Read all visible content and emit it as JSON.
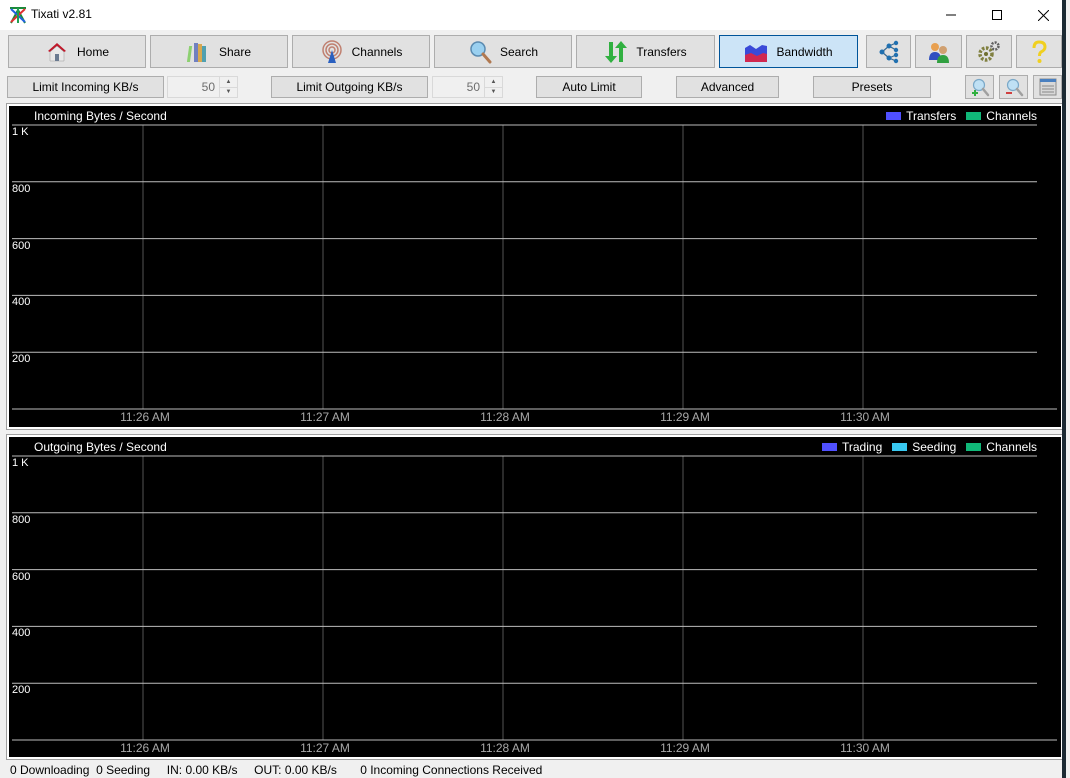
{
  "window": {
    "title": "Tixati v2.81",
    "controls": {
      "minimize": "minimize",
      "maximize": "maximize",
      "close": "close"
    }
  },
  "toolbar": {
    "buttons": [
      {
        "label": "Home",
        "icon": "home-icon",
        "active": false
      },
      {
        "label": "Share",
        "icon": "books-icon",
        "active": false
      },
      {
        "label": "Channels",
        "icon": "antenna-icon",
        "active": false
      },
      {
        "label": "Search",
        "icon": "magnifier-icon",
        "active": false
      },
      {
        "label": "Transfers",
        "icon": "up-down-arrows-icon",
        "active": false
      },
      {
        "label": "Bandwidth",
        "icon": "bandwidth-graph-icon",
        "active": true
      }
    ],
    "icon_buttons": [
      {
        "name": "peers-network-button",
        "icon": "network-nodes-icon"
      },
      {
        "name": "users-button",
        "icon": "users-icon"
      },
      {
        "name": "settings-button",
        "icon": "gears-icon"
      },
      {
        "name": "help-button",
        "icon": "question-mark-icon"
      }
    ]
  },
  "bandwidth_toolbar": {
    "limit_incoming_label": "Limit Incoming KB/s",
    "limit_incoming_value": "50",
    "limit_outgoing_label": "Limit Outgoing KB/s",
    "limit_outgoing_value": "50",
    "auto_limit_label": "Auto Limit",
    "advanced_label": "Advanced",
    "presets_label": "Presets",
    "zoom_in": "zoom-in",
    "zoom_out": "zoom-out",
    "view_options": "view-options"
  },
  "colors": {
    "transfers": "#5050ff",
    "trading": "#5050ff",
    "seeding": "#38c8f0",
    "channels": "#10b878",
    "accent": "#005499"
  },
  "chart_data": [
    {
      "type": "line",
      "title": "Incoming Bytes / Second",
      "xlabel": "",
      "ylabel": "",
      "y_ticks": [
        "200",
        "400",
        "600",
        "800",
        "1 K"
      ],
      "y_tick_values": [
        200,
        400,
        600,
        800,
        1000
      ],
      "ylim": [
        0,
        1000
      ],
      "x_ticks": [
        "11:26 AM",
        "11:27 AM",
        "11:28 AM",
        "11:29 AM",
        "11:30 AM"
      ],
      "grid": true,
      "legend_position": "top-right",
      "series": [
        {
          "name": "Transfers",
          "color": "#5050ff",
          "values": [
            0,
            0,
            0,
            0,
            0
          ]
        },
        {
          "name": "Channels",
          "color": "#10b878",
          "values": [
            0,
            0,
            0,
            0,
            0
          ]
        }
      ]
    },
    {
      "type": "line",
      "title": "Outgoing Bytes / Second",
      "xlabel": "",
      "ylabel": "",
      "y_ticks": [
        "200",
        "400",
        "600",
        "800",
        "1 K"
      ],
      "y_tick_values": [
        200,
        400,
        600,
        800,
        1000
      ],
      "ylim": [
        0,
        1000
      ],
      "x_ticks": [
        "11:26 AM",
        "11:27 AM",
        "11:28 AM",
        "11:29 AM",
        "11:30 AM"
      ],
      "grid": true,
      "legend_position": "top-right",
      "series": [
        {
          "name": "Trading",
          "color": "#5050ff",
          "values": [
            0,
            0,
            0,
            0,
            0
          ]
        },
        {
          "name": "Seeding",
          "color": "#38c8f0",
          "values": [
            0,
            0,
            0,
            0,
            0
          ]
        },
        {
          "name": "Channels",
          "color": "#10b878",
          "values": [
            0,
            0,
            0,
            0,
            0
          ]
        }
      ]
    }
  ],
  "status_bar": {
    "text": "0 Downloading  0 Seeding     IN: 0.00 KB/s     OUT: 0.00 KB/s       0 Incoming Connections Received",
    "downloading": "0 Downloading",
    "seeding": "0 Seeding",
    "in_rate": "IN: 0.00 KB/s",
    "out_rate": "OUT: 0.00 KB/s",
    "incoming_connections": "0 Incoming Connections Received"
  }
}
